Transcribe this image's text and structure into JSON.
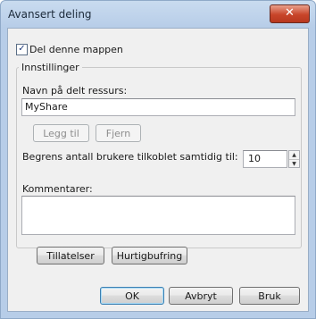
{
  "window": {
    "title": "Avansert deling",
    "close_glyph": "✕"
  },
  "share_checkbox": {
    "label": "Del denne mappen",
    "checked": true,
    "mark": "✓"
  },
  "settings": {
    "legend": "Innstillinger",
    "share_name_label": "Navn på delt ressurs:",
    "share_name_value": "MyShare",
    "add_button": "Legg til",
    "remove_button": "Fjern",
    "limit_label": "Begrens antall brukere tilkoblet samtidig til:",
    "limit_value": "10",
    "comments_label": "Kommentarer:",
    "comments_value": ""
  },
  "permissions_button": "Tillatelser",
  "caching_button": "Hurtigbufring",
  "footer": {
    "ok": "OK",
    "cancel": "Avbryt",
    "apply": "Bruk"
  },
  "icons": {
    "spin_up": "▲",
    "spin_down": "▼"
  }
}
